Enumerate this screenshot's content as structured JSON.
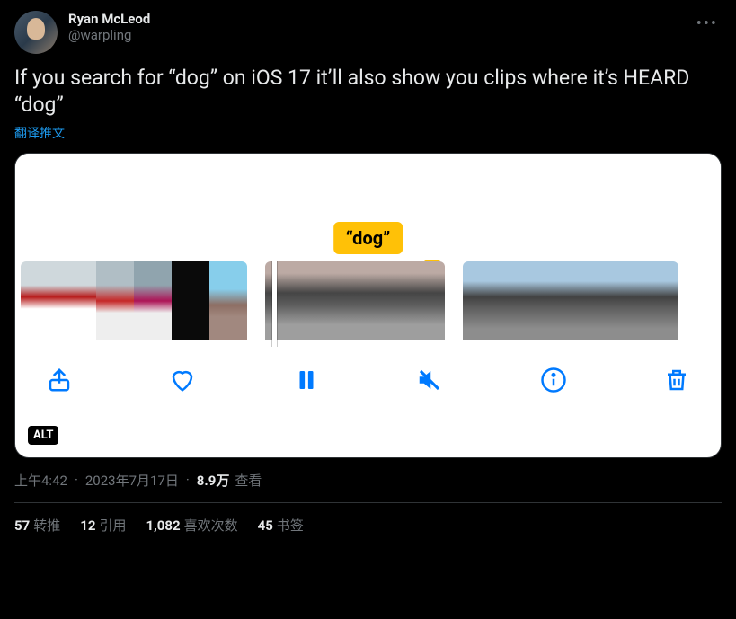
{
  "user": {
    "display_name": "Ryan McLeod",
    "handle": "@warpling"
  },
  "tweet_text": "If you search for “dog” on iOS 17 it’ll also show you clips where it’s HEARD “dog”",
  "translate_label": "翻译推文",
  "media": {
    "search_badge": "“dog”",
    "alt_badge": "ALT",
    "toolbar": {
      "share": "share-icon",
      "like": "heart-icon",
      "pause": "pause-icon",
      "mute": "mute-icon",
      "info": "info-icon",
      "trash": "trash-icon"
    }
  },
  "meta": {
    "time": "上午4:42",
    "date": "2023年7月17日",
    "views_count": "8.9万",
    "views_label": "查看"
  },
  "stats": {
    "retweets": {
      "count": "57",
      "label": "转推"
    },
    "quotes": {
      "count": "12",
      "label": "引用"
    },
    "likes": {
      "count": "1,082",
      "label": "喜欢次数"
    },
    "bookmarks": {
      "count": "45",
      "label": "书签"
    }
  }
}
